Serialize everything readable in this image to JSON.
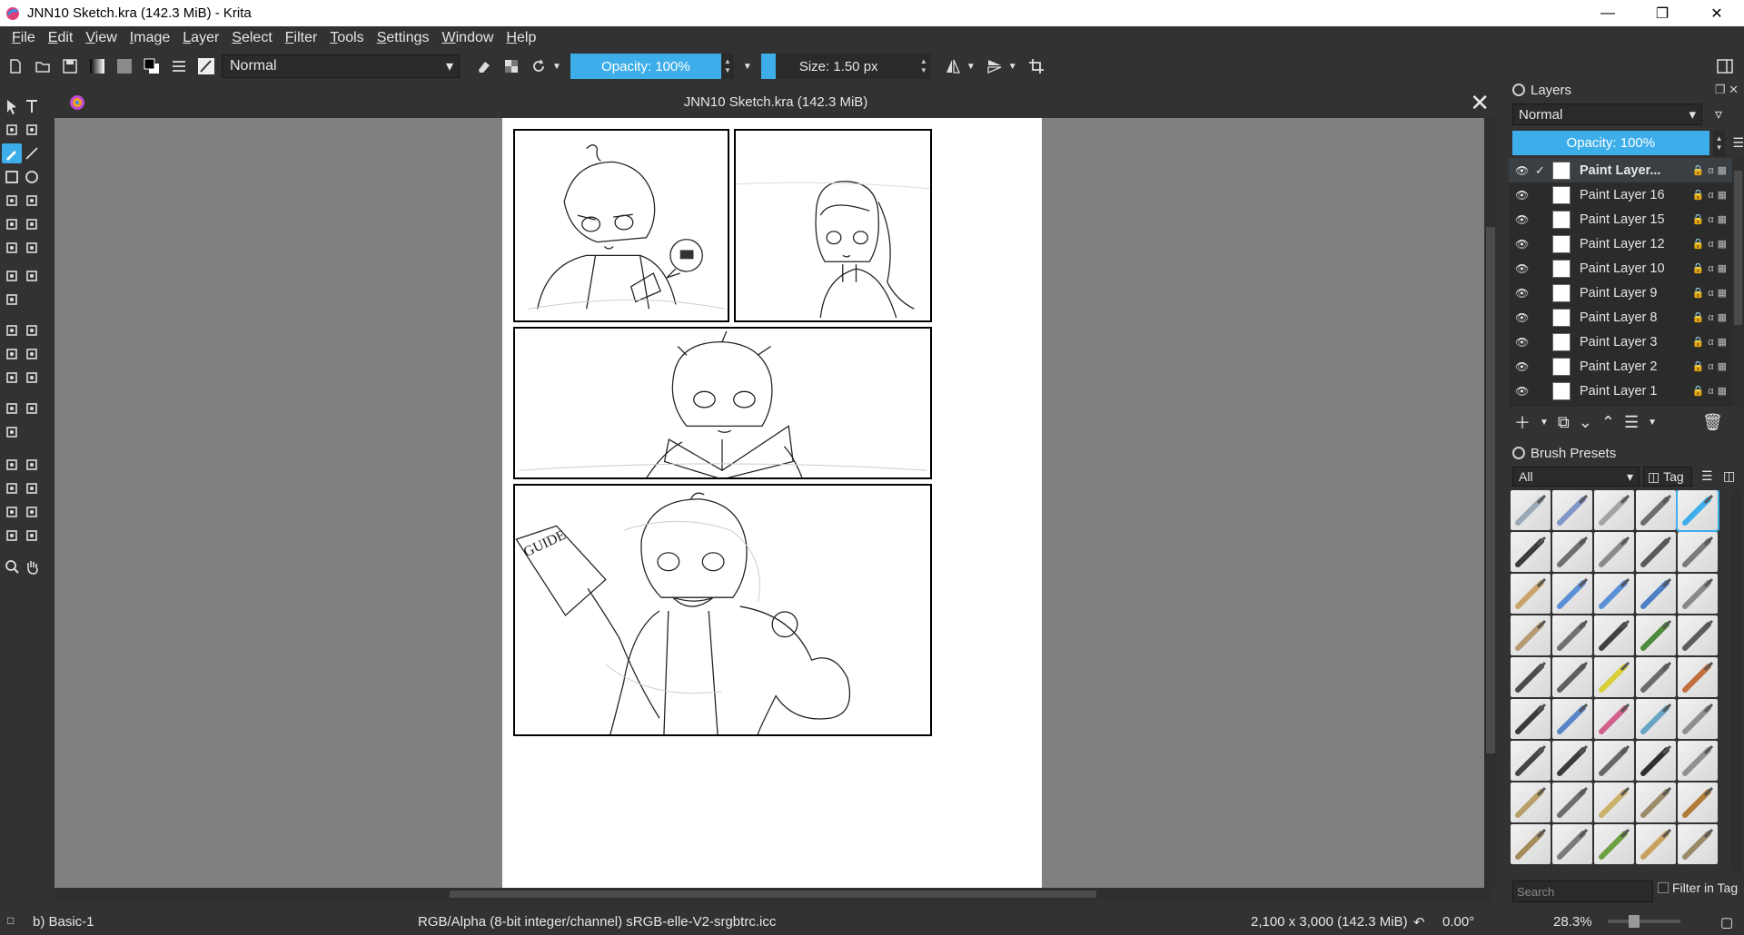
{
  "window": {
    "title": "JNN10 Sketch.kra (142.3 MiB)  - Krita",
    "controls": [
      "minimize-icon",
      "restore-icon",
      "close-icon"
    ]
  },
  "menu": [
    "File",
    "Edit",
    "View",
    "Image",
    "Layer",
    "Select",
    "Filter",
    "Tools",
    "Settings",
    "Window",
    "Help"
  ],
  "toolbar": {
    "blend_mode": "Normal",
    "opacity": "Opacity: 100%",
    "size": "Size: 1.50 px"
  },
  "document": {
    "tab_title": "JNN10 Sketch.kra (142.3 MiB)"
  },
  "layers": {
    "title": "Layers",
    "blend_mode": "Normal",
    "opacity": "Opacity:  100%",
    "items": [
      {
        "name": "Paint Layer...",
        "selected": true
      },
      {
        "name": "Paint Layer 16",
        "selected": false
      },
      {
        "name": "Paint Layer 15",
        "selected": false
      },
      {
        "name": "Paint Layer 12",
        "selected": false
      },
      {
        "name": "Paint Layer 10",
        "selected": false
      },
      {
        "name": "Paint Layer 9",
        "selected": false
      },
      {
        "name": "Paint Layer 8",
        "selected": false
      },
      {
        "name": "Paint Layer 3",
        "selected": false
      },
      {
        "name": "Paint Layer 2",
        "selected": false
      },
      {
        "name": "Paint Layer 1",
        "selected": false
      }
    ]
  },
  "brushes": {
    "title": "Brush Presets",
    "filter": "All",
    "tag": "Tag",
    "search_placeholder": "Search",
    "filter_in_tag": "Filter in Tag",
    "colors": [
      "#9aa7b4",
      "#7f95c8",
      "#a4a4a4",
      "#6d6d6d",
      "#3daee9",
      "#3b3b3b",
      "#6f6f6f",
      "#8a8a8a",
      "#5a5a5a",
      "#7a7a7a",
      "#c9a46a",
      "#5b8fd6",
      "#5b8fd6",
      "#4d7fc4",
      "#888888",
      "#b79b73",
      "#707070",
      "#3f3f3f",
      "#4f8a3c",
      "#5c5c5c",
      "#4a4a4a",
      "#606060",
      "#d8cf3a",
      "#6a6a6a",
      "#c0703d",
      "#3b3b3b",
      "#5a86c8",
      "#d25f8c",
      "#6aa3c4",
      "#8f8f8f",
      "#444444",
      "#3a3a3a",
      "#686868",
      "#2f2f2f",
      "#909090",
      "#b8a06a",
      "#6e6e6e",
      "#c9b16c",
      "#9c8b6a",
      "#b07c3a",
      "#a58a5a",
      "#7a7a7a",
      "#6ea040",
      "#c8a060",
      "#9a8a6a"
    ]
  },
  "status": {
    "brush": "b) Basic-1",
    "color_space": "RGB/Alpha (8-bit integer/channel)  sRGB-elle-V2-srgbtrc.icc",
    "image_size": "2,100 x 3,000 (142.3 MiB)",
    "rotation": "0.00°",
    "zoom": "28.3%"
  }
}
